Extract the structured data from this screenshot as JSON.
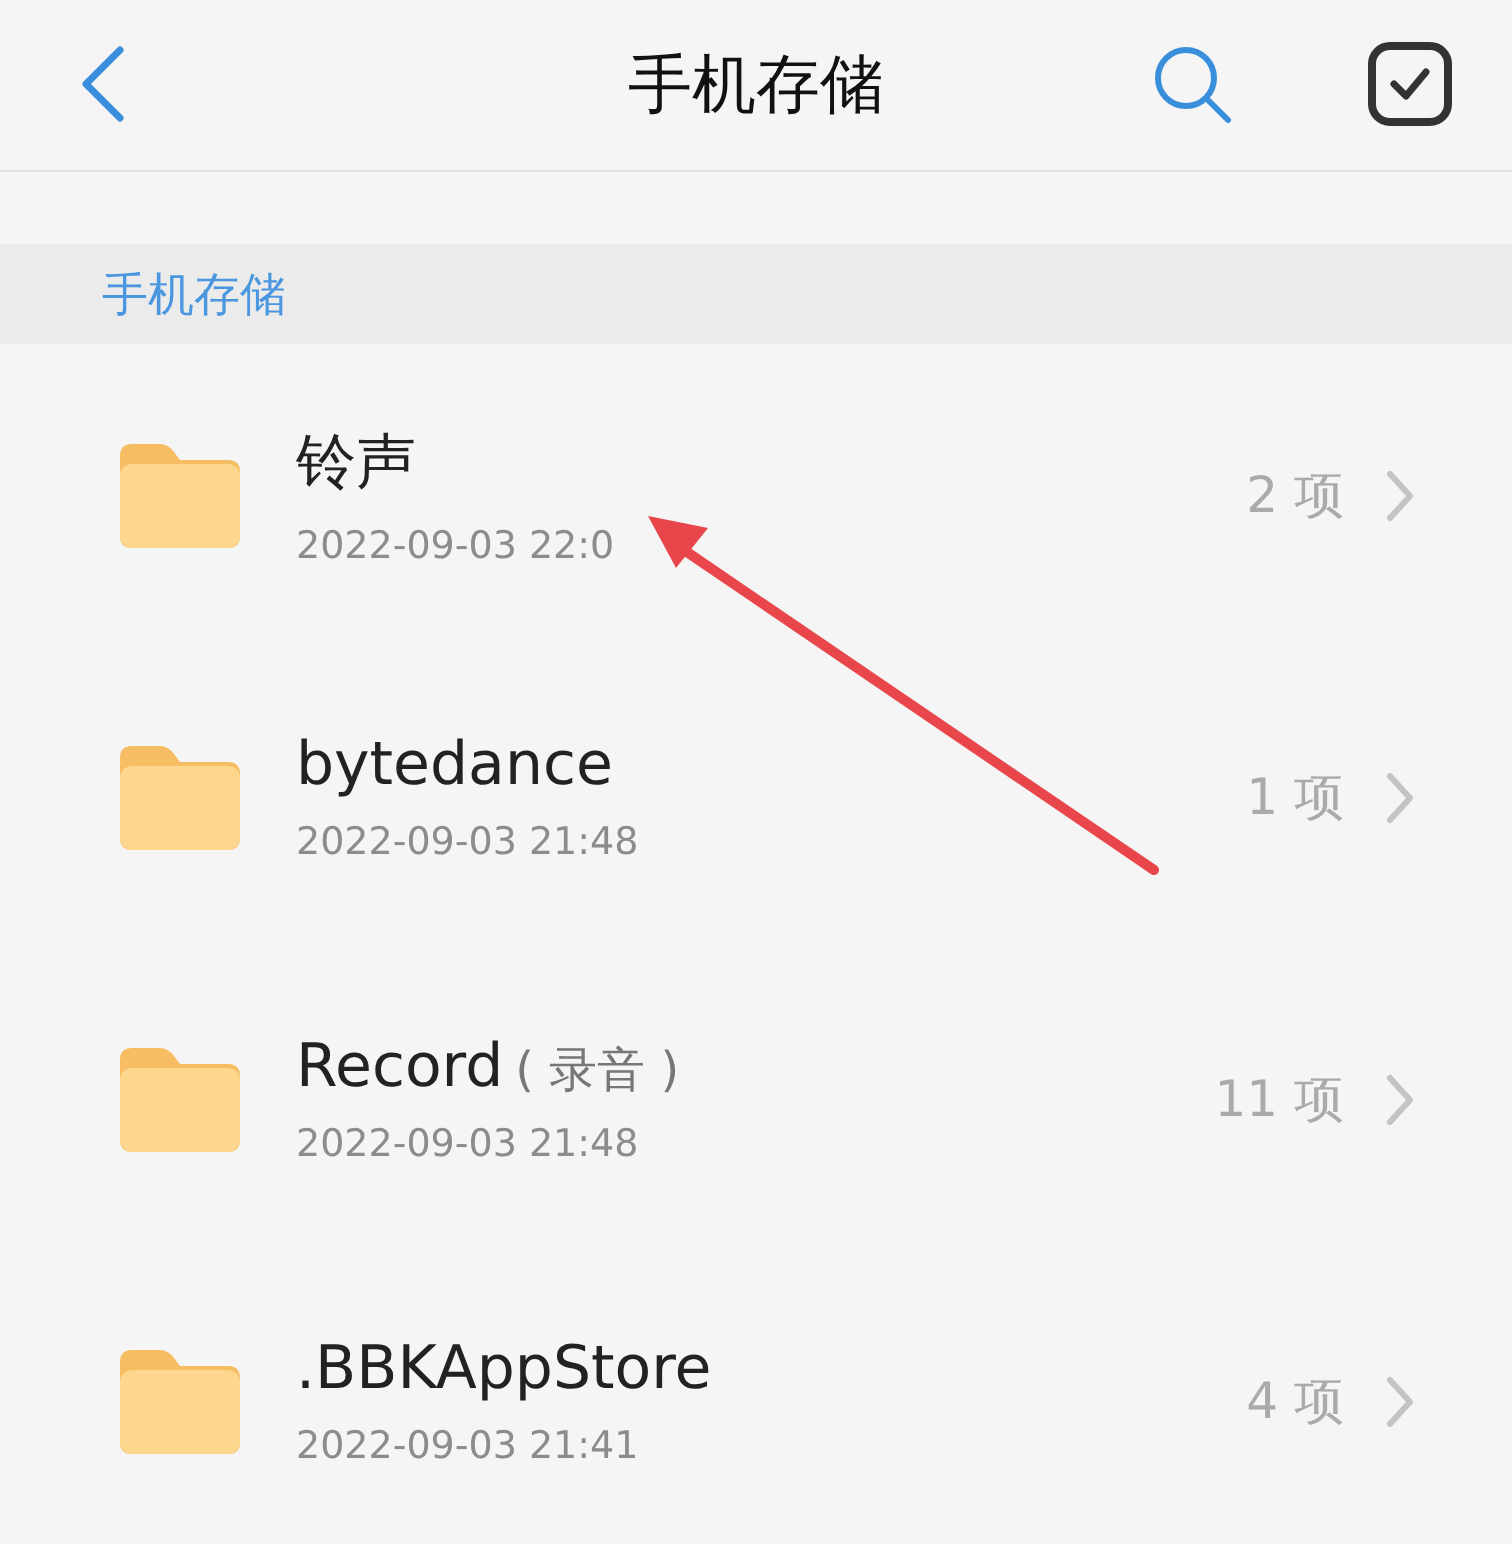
{
  "header": {
    "title": "手机存储"
  },
  "section": {
    "label": "手机存储"
  },
  "folders": [
    {
      "name": "铃声",
      "date": "2022-09-03 22:0",
      "count": "2 项"
    },
    {
      "name": "bytedance",
      "date": "2022-09-03 21:48",
      "count": "1 项"
    },
    {
      "name": "Record",
      "note": "( 录音 )",
      "date": "2022-09-03 21:48",
      "count": "11 项"
    },
    {
      "name": ".BBKAppStore",
      "date": "2022-09-03 21:41",
      "count": "4 项"
    }
  ],
  "annotation": {
    "kind": "arrow",
    "color": "#e8464a"
  }
}
